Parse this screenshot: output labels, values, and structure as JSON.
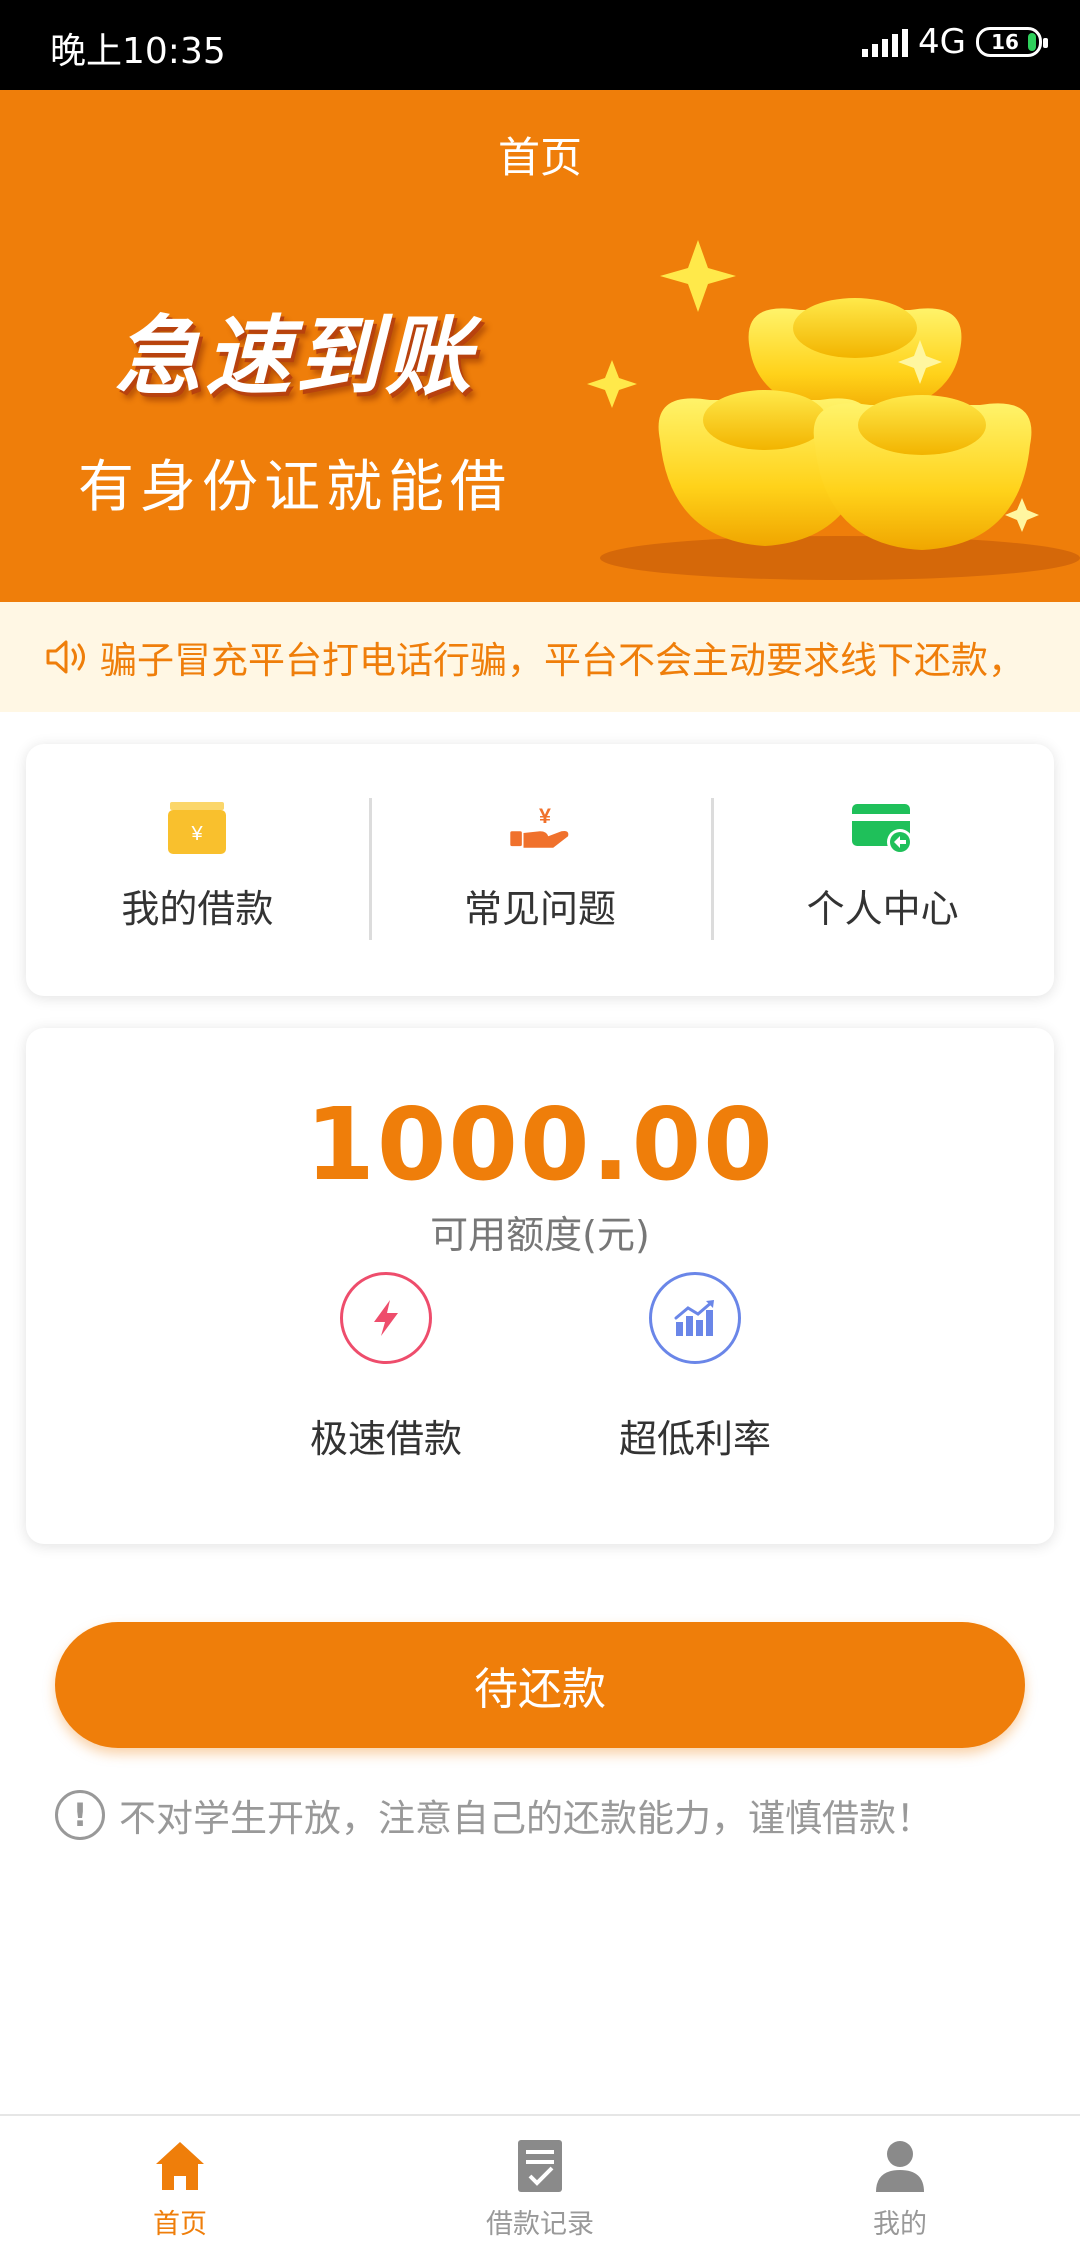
{
  "status_bar": {
    "time": "晚上10:35",
    "network": "4G",
    "battery": "16"
  },
  "header": {
    "title": "首页"
  },
  "banner": {
    "headline": "急速到账",
    "subline": "有身份证就能借"
  },
  "notice": {
    "text": "骗子冒充平台打电话行骗，平台不会主动要求线下还款，"
  },
  "menu": {
    "items": [
      {
        "label": "我的借款",
        "icon": "wallet-icon",
        "color": "#f9c02d"
      },
      {
        "label": "常见问题",
        "icon": "hand-yuan-icon",
        "color": "#f0712c"
      },
      {
        "label": "个人中心",
        "icon": "card-icon",
        "color": "#1fc05a"
      }
    ]
  },
  "credit": {
    "amount": "1000.00",
    "caption": "可用额度(元)",
    "features": [
      {
        "label": "极速借款",
        "icon": "lightning-icon",
        "color": "#ee4d6c"
      },
      {
        "label": "超低利率",
        "icon": "trend-chart-icon",
        "color": "#6a86e8"
      }
    ]
  },
  "action": {
    "button_label": "待还款"
  },
  "warning": {
    "icon_glyph": "!",
    "text": "不对学生开放，注意自己的还款能力，谨慎借款！"
  },
  "tabbar": {
    "items": [
      {
        "label": "首页",
        "icon": "home-icon",
        "active": true
      },
      {
        "label": "借款记录",
        "icon": "document-icon",
        "active": false
      },
      {
        "label": "我的",
        "icon": "user-icon",
        "active": false
      }
    ]
  },
  "colors": {
    "brand": "#ef7e0a",
    "notice_bg": "#fff7e4",
    "muted": "#999999"
  }
}
